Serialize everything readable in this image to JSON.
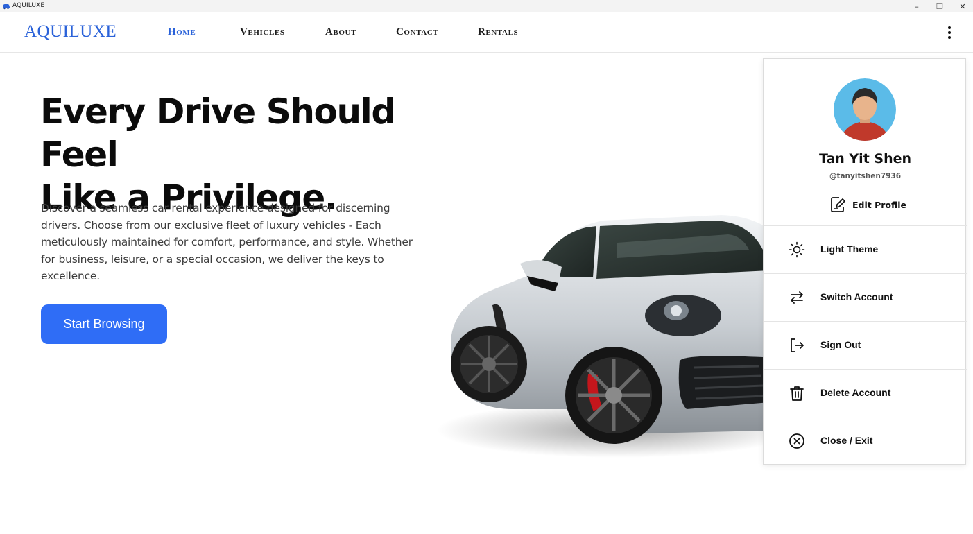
{
  "window": {
    "title": "AQUILUXE",
    "minimize_glyph": "–",
    "maximize_glyph": "❐",
    "close_glyph": "✕"
  },
  "navbar": {
    "logo": "AQUILUXE",
    "links": [
      {
        "label": "Home",
        "active": true
      },
      {
        "label": "Vehicles",
        "active": false
      },
      {
        "label": "About",
        "active": false
      },
      {
        "label": "Contact",
        "active": false
      },
      {
        "label": "Rentals",
        "active": false
      }
    ],
    "more_icon": "kebab-menu-icon"
  },
  "hero": {
    "title_line1": "Every Drive Should Feel",
    "title_line2": "Like a Privilege.",
    "description": "Discover a seamless car rental experience designed for discerning drivers. Choose from our exclusive fleet of luxury vehicles - Each meticulously maintained for comfort, performance, and style. Whether for business, leisure, or a special occasion, we deliver the keys to excellence.",
    "cta_label": "Start Browsing"
  },
  "profile_menu": {
    "name": "Tan Yit Shen",
    "handle": "@tanyitshen7936",
    "edit_label": "Edit Profile",
    "items": [
      {
        "label": "Light Theme",
        "icon": "sun-icon"
      },
      {
        "label": "Switch Account",
        "icon": "swap-arrows-icon"
      },
      {
        "label": "Sign Out",
        "icon": "sign-out-icon"
      },
      {
        "label": "Delete Account",
        "icon": "trash-icon"
      },
      {
        "label": "Close / Exit",
        "icon": "close-circle-icon"
      }
    ]
  },
  "colors": {
    "brand": "#2a62d9",
    "cta": "#2f6df6",
    "text": "#0b0b0b"
  }
}
